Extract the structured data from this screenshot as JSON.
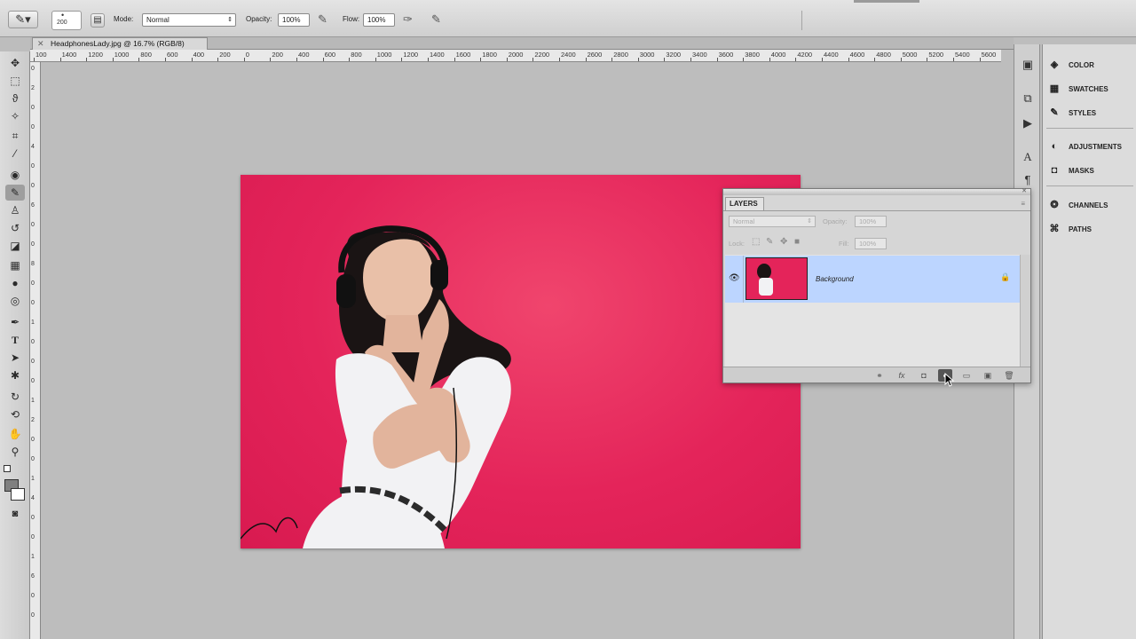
{
  "options_bar": {
    "brush_size": "200",
    "mode_label": "Mode:",
    "mode_value": "Normal",
    "opacity_label": "Opacity:",
    "opacity_value": "100%",
    "flow_label": "Flow:",
    "flow_value": "100%"
  },
  "document": {
    "tab_title": "HeadphonesLady.jpg @ 16.7% (RGB/8)"
  },
  "ruler": {
    "h_labels": [
      "100",
      "1400",
      "1200",
      "1000",
      "800",
      "600",
      "400",
      "200",
      "0",
      "200",
      "400",
      "600",
      "800",
      "1000",
      "1200",
      "1400",
      "1600",
      "1800",
      "2000",
      "2200",
      "2400",
      "2600",
      "2800",
      "3000",
      "3200",
      "3400",
      "3600",
      "3800",
      "4000",
      "4200",
      "4400",
      "4600",
      "4800",
      "5000",
      "5200",
      "5400",
      "5600"
    ],
    "v_labels": [
      "0",
      "2",
      "0",
      "0",
      "4",
      "0",
      "0",
      "6",
      "0",
      "0",
      "8",
      "0",
      "0",
      "1",
      "0",
      "0",
      "0",
      "1",
      "2",
      "0",
      "0",
      "1",
      "4",
      "0",
      "0",
      "1",
      "6",
      "0",
      "0"
    ]
  },
  "panels": {
    "group1": [
      {
        "icon": "color-icon",
        "label": "COLOR"
      },
      {
        "icon": "swatches-icon",
        "label": "SWATCHES"
      },
      {
        "icon": "styles-icon",
        "label": "STYLES"
      }
    ],
    "group2": [
      {
        "icon": "adjustments-icon",
        "label": "ADJUSTMENTS"
      },
      {
        "icon": "masks-icon",
        "label": "MASKS"
      }
    ],
    "group3": [
      {
        "icon": "channels-icon",
        "label": "CHANNELS"
      },
      {
        "icon": "paths-icon",
        "label": "PATHS"
      }
    ]
  },
  "layers_panel": {
    "tab_label": "LAYERS",
    "blend_mode": "Normal",
    "opacity_label": "Opacity:",
    "opacity_value": "100%",
    "lock_label": "Lock:",
    "fill_label": "Fill:",
    "fill_value": "100%",
    "layers": [
      {
        "name": "Background",
        "selected": true,
        "locked": true,
        "visible": true
      }
    ]
  },
  "colors": {
    "accent_selection": "#bcd5ff",
    "photo_background": "#e4245a"
  }
}
